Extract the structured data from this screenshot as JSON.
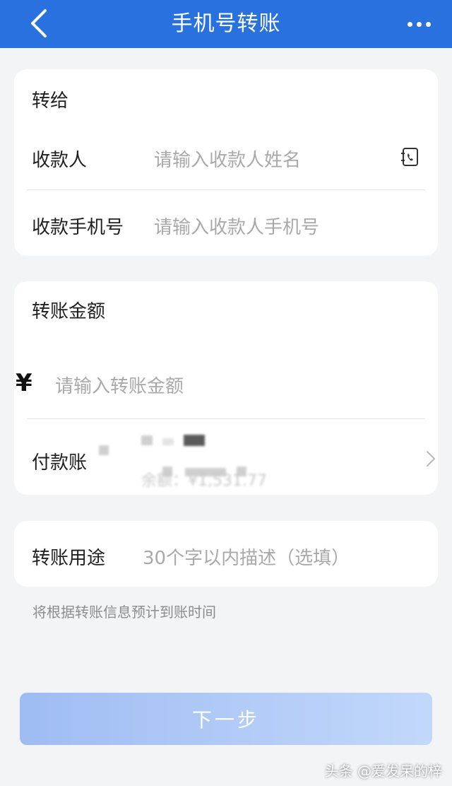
{
  "header": {
    "title": "手机号转账",
    "back_icon": "chevron-left-icon",
    "more_icon": "more-dots-icon",
    "background": "#2a71e0"
  },
  "recipient_section": {
    "title": "转给",
    "payee_label": "收款人",
    "payee_placeholder": "请输入收款人姓名",
    "contact_icon": "contact-book-icon",
    "phone_label": "收款手机号",
    "phone_placeholder": "请输入收款人手机号"
  },
  "amount_section": {
    "title": "转账金额",
    "currency_symbol": "¥",
    "amount_placeholder": "请输入转账金额",
    "payer_label": "付款账",
    "balance_text": "余额：¥1,531.77"
  },
  "purpose_section": {
    "label": "转账用途",
    "placeholder": "30个字以内描述（选填）"
  },
  "hint": "将根据转账信息预计到账时间",
  "next_button": "下一步",
  "watermark": "头条 @爱发呆的梓"
}
